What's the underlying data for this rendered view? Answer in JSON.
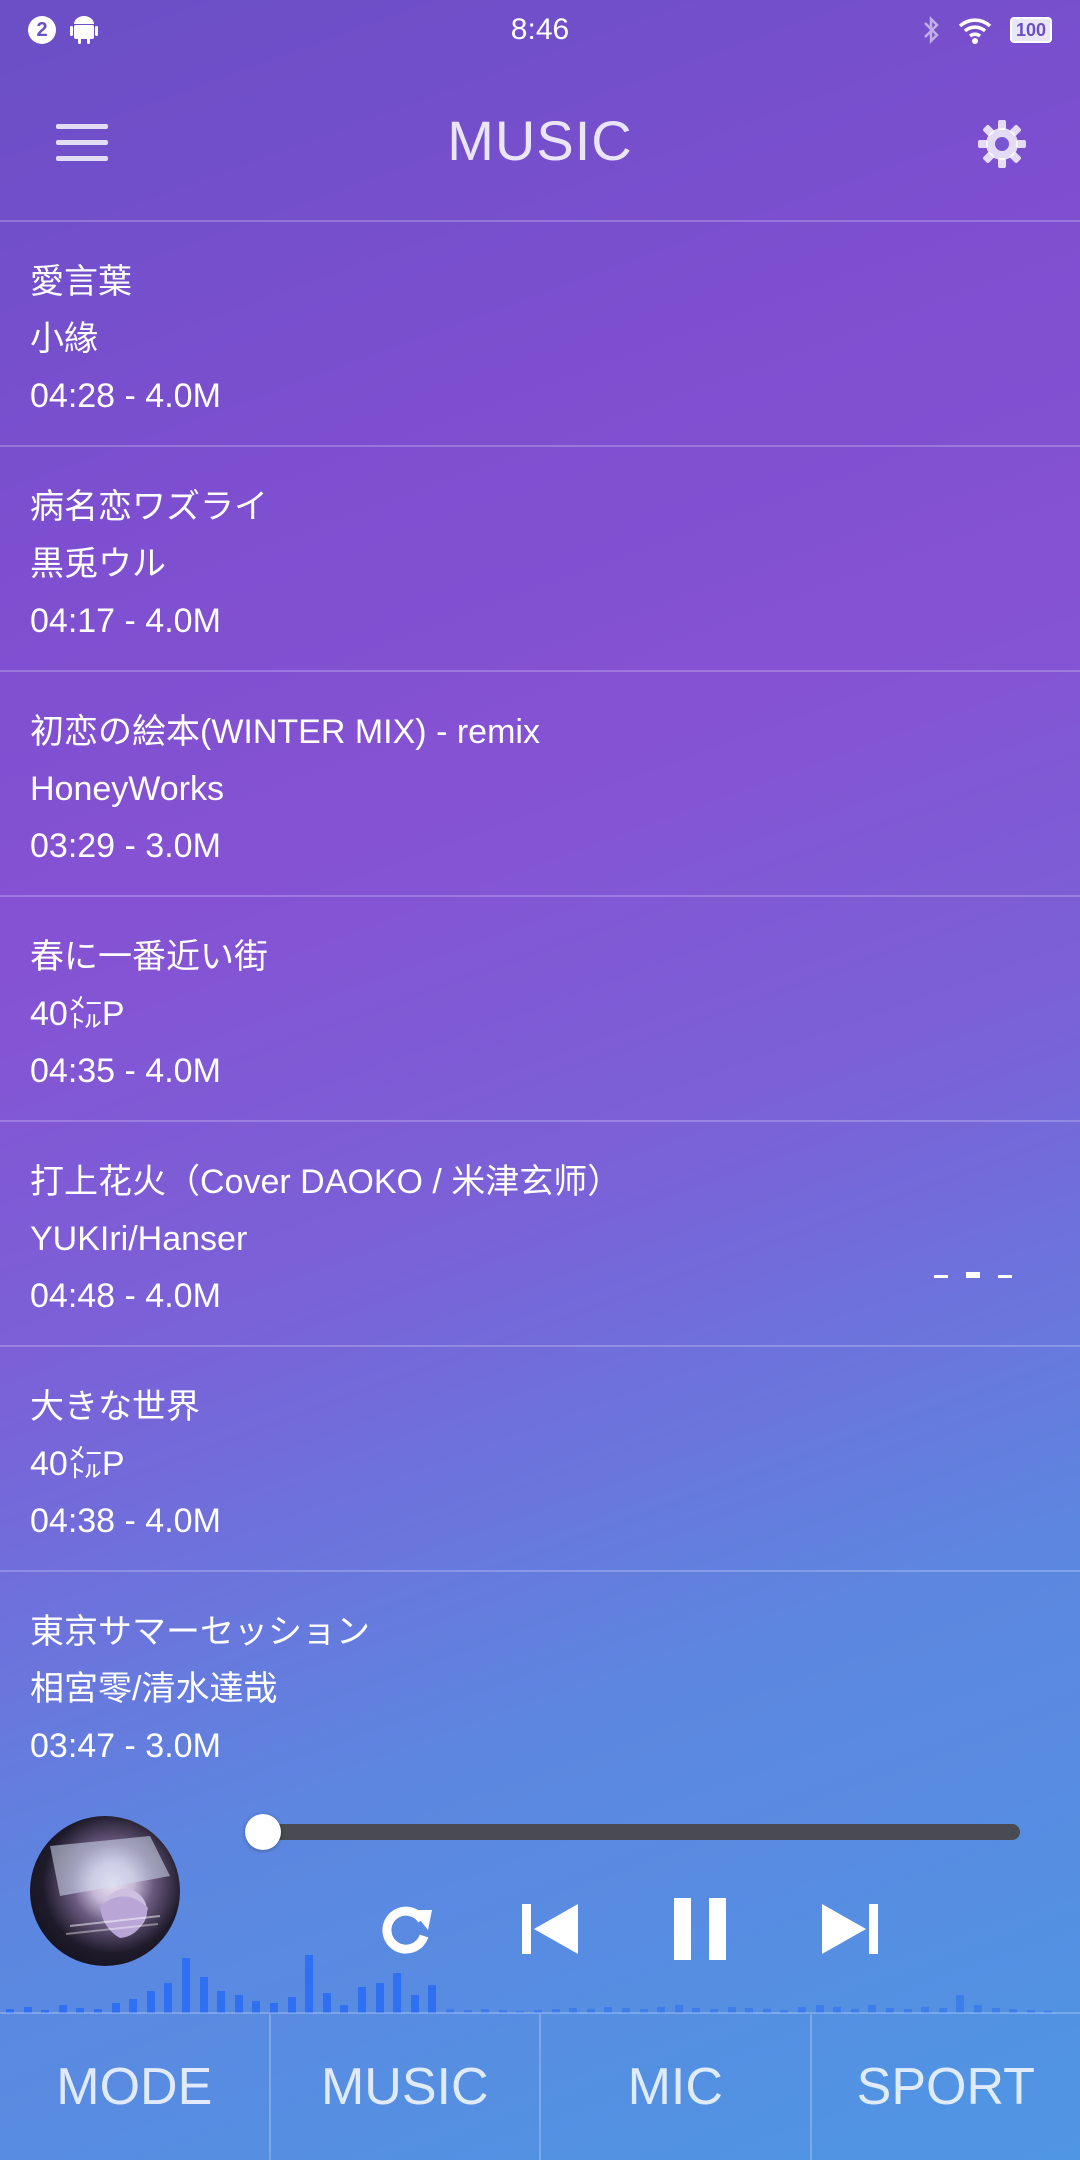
{
  "status_bar": {
    "notification_count": "2",
    "time": "8:46",
    "battery": "100",
    "icons": [
      "android-icon",
      "bluetooth-icon",
      "wifi-icon",
      "battery-icon"
    ]
  },
  "header": {
    "title": "MUSIC",
    "menu_icon": "hamburger-menu-icon",
    "settings_icon": "gear-icon"
  },
  "songs": [
    {
      "title": "愛言葉",
      "artist": "小緣",
      "meta": "04:28 - 4.0M"
    },
    {
      "title": "病名恋ワズライ",
      "artist": "黒兎ウル",
      "meta": "04:17 - 4.0M"
    },
    {
      "title": "初恋の絵本(WINTER MIX) - remix",
      "artist": "HoneyWorks",
      "meta": "03:29 - 3.0M"
    },
    {
      "title": "春に一番近い街",
      "artist": "40㍍P",
      "meta": "04:35 - 4.0M"
    },
    {
      "title": "打上花火（Cover DAOKO / 米津玄师）",
      "artist": "YUKIri/Hanser",
      "meta": "04:48 - 4.0M",
      "playing": true
    },
    {
      "title": "大きな世界",
      "artist": "40㍍P",
      "meta": "04:38 - 4.0M"
    },
    {
      "title": "東京サマーセッション",
      "artist": "相宮零/清水達哉",
      "meta": "03:47 - 3.0M"
    }
  ],
  "player": {
    "progress": 0.02,
    "controls": [
      "repeat-icon",
      "previous-icon",
      "pause-icon",
      "next-icon"
    ],
    "visualizer_color": "#2f6ff2"
  },
  "nav": {
    "tabs": [
      "MODE",
      "MUSIC",
      "MIC",
      "SPORT"
    ]
  }
}
